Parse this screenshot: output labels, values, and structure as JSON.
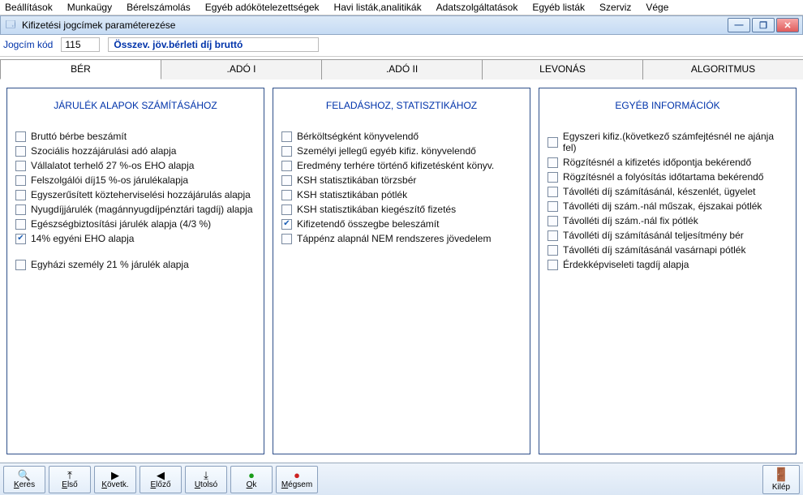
{
  "menu": [
    "Beállítások",
    "Munkaügy",
    "Bérelszámolás",
    "Egyéb adókötelezettségek",
    "Havi listák,analitikák",
    "Adatszolgáltatások",
    "Egyéb listák",
    "Szerviz",
    "Vége"
  ],
  "window": {
    "title": "Kifizetési jogcímek paraméterezése"
  },
  "head": {
    "code_label": "Jogcím kód",
    "code_value": "115",
    "desc_value": "Összev. jöv.bérleti díj bruttó"
  },
  "tabs": [
    "BÉR",
    ".ADÓ I",
    ".ADÓ II",
    "LEVONÁS",
    "ALGORITMUS"
  ],
  "panels": {
    "left": {
      "title": "JÁRULÉK ALAPOK SZÁMÍTÁSÁHOZ",
      "items": [
        {
          "label": "Bruttó bérbe beszámít",
          "checked": false
        },
        {
          "label": "Szociális hozzájárulási adó alapja",
          "checked": false
        },
        {
          "label": "Vállalatot terhelő 27 %-os EHO alapja",
          "checked": false
        },
        {
          "label": "Felszolgálói díj15 %-os járulékalapja",
          "checked": false
        },
        {
          "label": "Egyszerűsített közteherviselési hozzájárulás alapja",
          "checked": false
        },
        {
          "label": "Nyugdíjjárulék (magánnyugdíjpénztári tagdíj) alapja",
          "checked": false
        },
        {
          "label": "Egészségbiztosítási járulék alapja (4/3 %)",
          "checked": false
        },
        {
          "label": "14% egyéni EHO alapja",
          "checked": true
        }
      ],
      "extra": {
        "label": "Egyházi személy 21 % járulék alapja",
        "checked": false
      }
    },
    "mid": {
      "title": "FELADÁSHOZ, STATISZTIKÁHOZ",
      "items": [
        {
          "label": "Bérköltségként könyvelendő",
          "checked": false
        },
        {
          "label": "Személyi jellegű egyéb kifiz. könyvelendő",
          "checked": false
        },
        {
          "label": "Eredmény terhére történő kifizetésként könyv.",
          "checked": false
        },
        {
          "label": "KSH statisztikában törzsbér",
          "checked": false
        },
        {
          "label": "KSH statisztikában pótlék",
          "checked": false
        },
        {
          "label": "KSH statisztikában kiegészítő fizetés",
          "checked": false
        },
        {
          "label": "Kifizetendő összegbe beleszámít",
          "checked": true
        },
        {
          "label": "Táppénz alapnál NEM rendszeres jövedelem",
          "checked": false
        }
      ]
    },
    "right": {
      "title": "EGYÉB INFORMÁCIÓK",
      "items": [
        {
          "label": "Egyszeri kifiz.(következő számfejtésnél ne ajánja fel)",
          "checked": false
        },
        {
          "label": "Rögzítésnél a kifizetés időpontja bekérendő",
          "checked": false
        },
        {
          "label": "Rögzítésnél a folyósítás időtartama bekérendő",
          "checked": false
        },
        {
          "label": "Távolléti díj számításánál, készenlét, ügyelet",
          "checked": false
        },
        {
          "label": "Távolléti dij szám.-nál műszak, éjszakai pótlék",
          "checked": false
        },
        {
          "label": "Távolléti díj szám.-nál fix pótlék",
          "checked": false
        },
        {
          "label": "Távolléti díj számításánál teljesítmény bér",
          "checked": false
        },
        {
          "label": "Távolléti díj számításánál vasárnapi pótlék",
          "checked": false
        },
        {
          "label": "Érdekképviseleti tagdíj alapja",
          "checked": false
        }
      ]
    }
  },
  "buttons": {
    "keres": "Keres",
    "elso": "Első",
    "kovetk": "Követk.",
    "elozo": "Előző",
    "utolso": "Utolsó",
    "ok": "Ok",
    "megsem": "Mégsem",
    "kilep": "Kilép"
  }
}
